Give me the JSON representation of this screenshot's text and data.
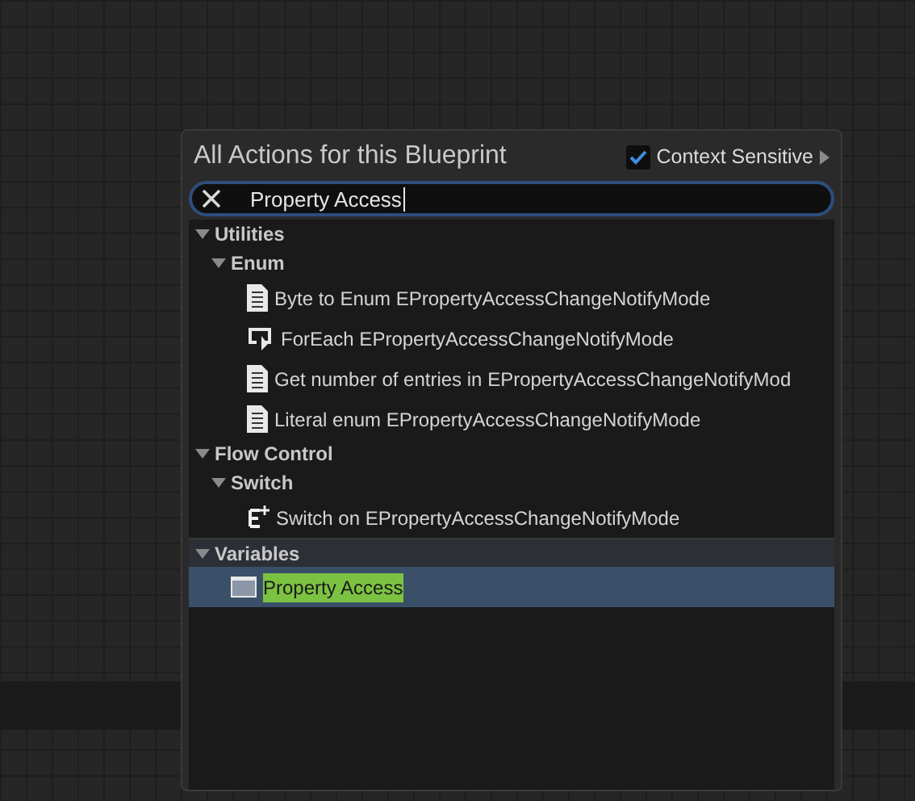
{
  "menu": {
    "title": "All Actions for this Blueprint",
    "context_sensitive": {
      "label": "Context Sensitive",
      "checked": true
    },
    "search": {
      "value": "Property Access"
    },
    "tree": [
      {
        "kind": "category",
        "label": "Utilities",
        "expanded": true,
        "children": [
          {
            "kind": "category",
            "label": "Enum",
            "expanded": true,
            "children": [
              {
                "kind": "function",
                "label": "Byte to Enum EPropertyAccessChangeNotifyMode",
                "selected": false
              },
              {
                "kind": "loop",
                "label": "ForEach EPropertyAccessChangeNotifyMode",
                "selected": false
              },
              {
                "kind": "function",
                "label": "Get number of entries in EPropertyAccessChangeNotifyMod",
                "selected": false
              },
              {
                "kind": "function",
                "label": "Literal enum EPropertyAccessChangeNotifyMode",
                "selected": false
              }
            ]
          }
        ]
      },
      {
        "kind": "category",
        "label": "Flow Control",
        "expanded": true,
        "children": [
          {
            "kind": "category",
            "label": "Switch",
            "expanded": true,
            "children": [
              {
                "kind": "switch",
                "label": "Switch on EPropertyAccessChangeNotifyMode",
                "selected": false
              }
            ]
          }
        ]
      },
      {
        "kind": "category",
        "label": "Variables",
        "expanded": true,
        "children": [
          {
            "kind": "variable",
            "label": "Property Access",
            "selected": true,
            "highlighted": true
          }
        ]
      }
    ]
  }
}
